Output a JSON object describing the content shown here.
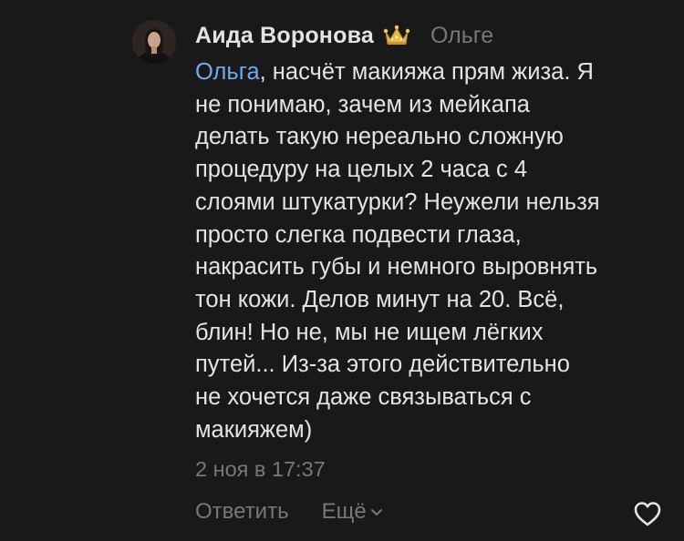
{
  "comment": {
    "author": "Аида Воронова",
    "badge_icon": "crown-icon",
    "reply_to": "Ольге",
    "mention": "Ольга",
    "text": ", насчёт макияжа прям жиза. Я\nне понимаю, зачем из мейкапа\nделать такую нереально сложную\nпроцедуру на целых 2 часа с 4\nслоями штукатурки? Неужели нельзя\nпросто слегка подвести глаза,\nнакрасить губы и немного выровнять\nтон кожи. Делов минут на 20. Всё,\nблин! Но не, мы не ищем лёгких\nпутей... Из-за этого действительно\nне хочется даже связываться с\nмакияжем)",
    "timestamp": "2 ноя в 17:37"
  },
  "actions": {
    "reply_label": "Ответить",
    "more_label": "Ещё",
    "more_icon": "chevron-down-icon",
    "like_icon": "heart-icon"
  },
  "colors": {
    "background": "#19191a",
    "text": "#e1e3e6",
    "secondary": "#76787a",
    "link": "#71aaeb"
  }
}
